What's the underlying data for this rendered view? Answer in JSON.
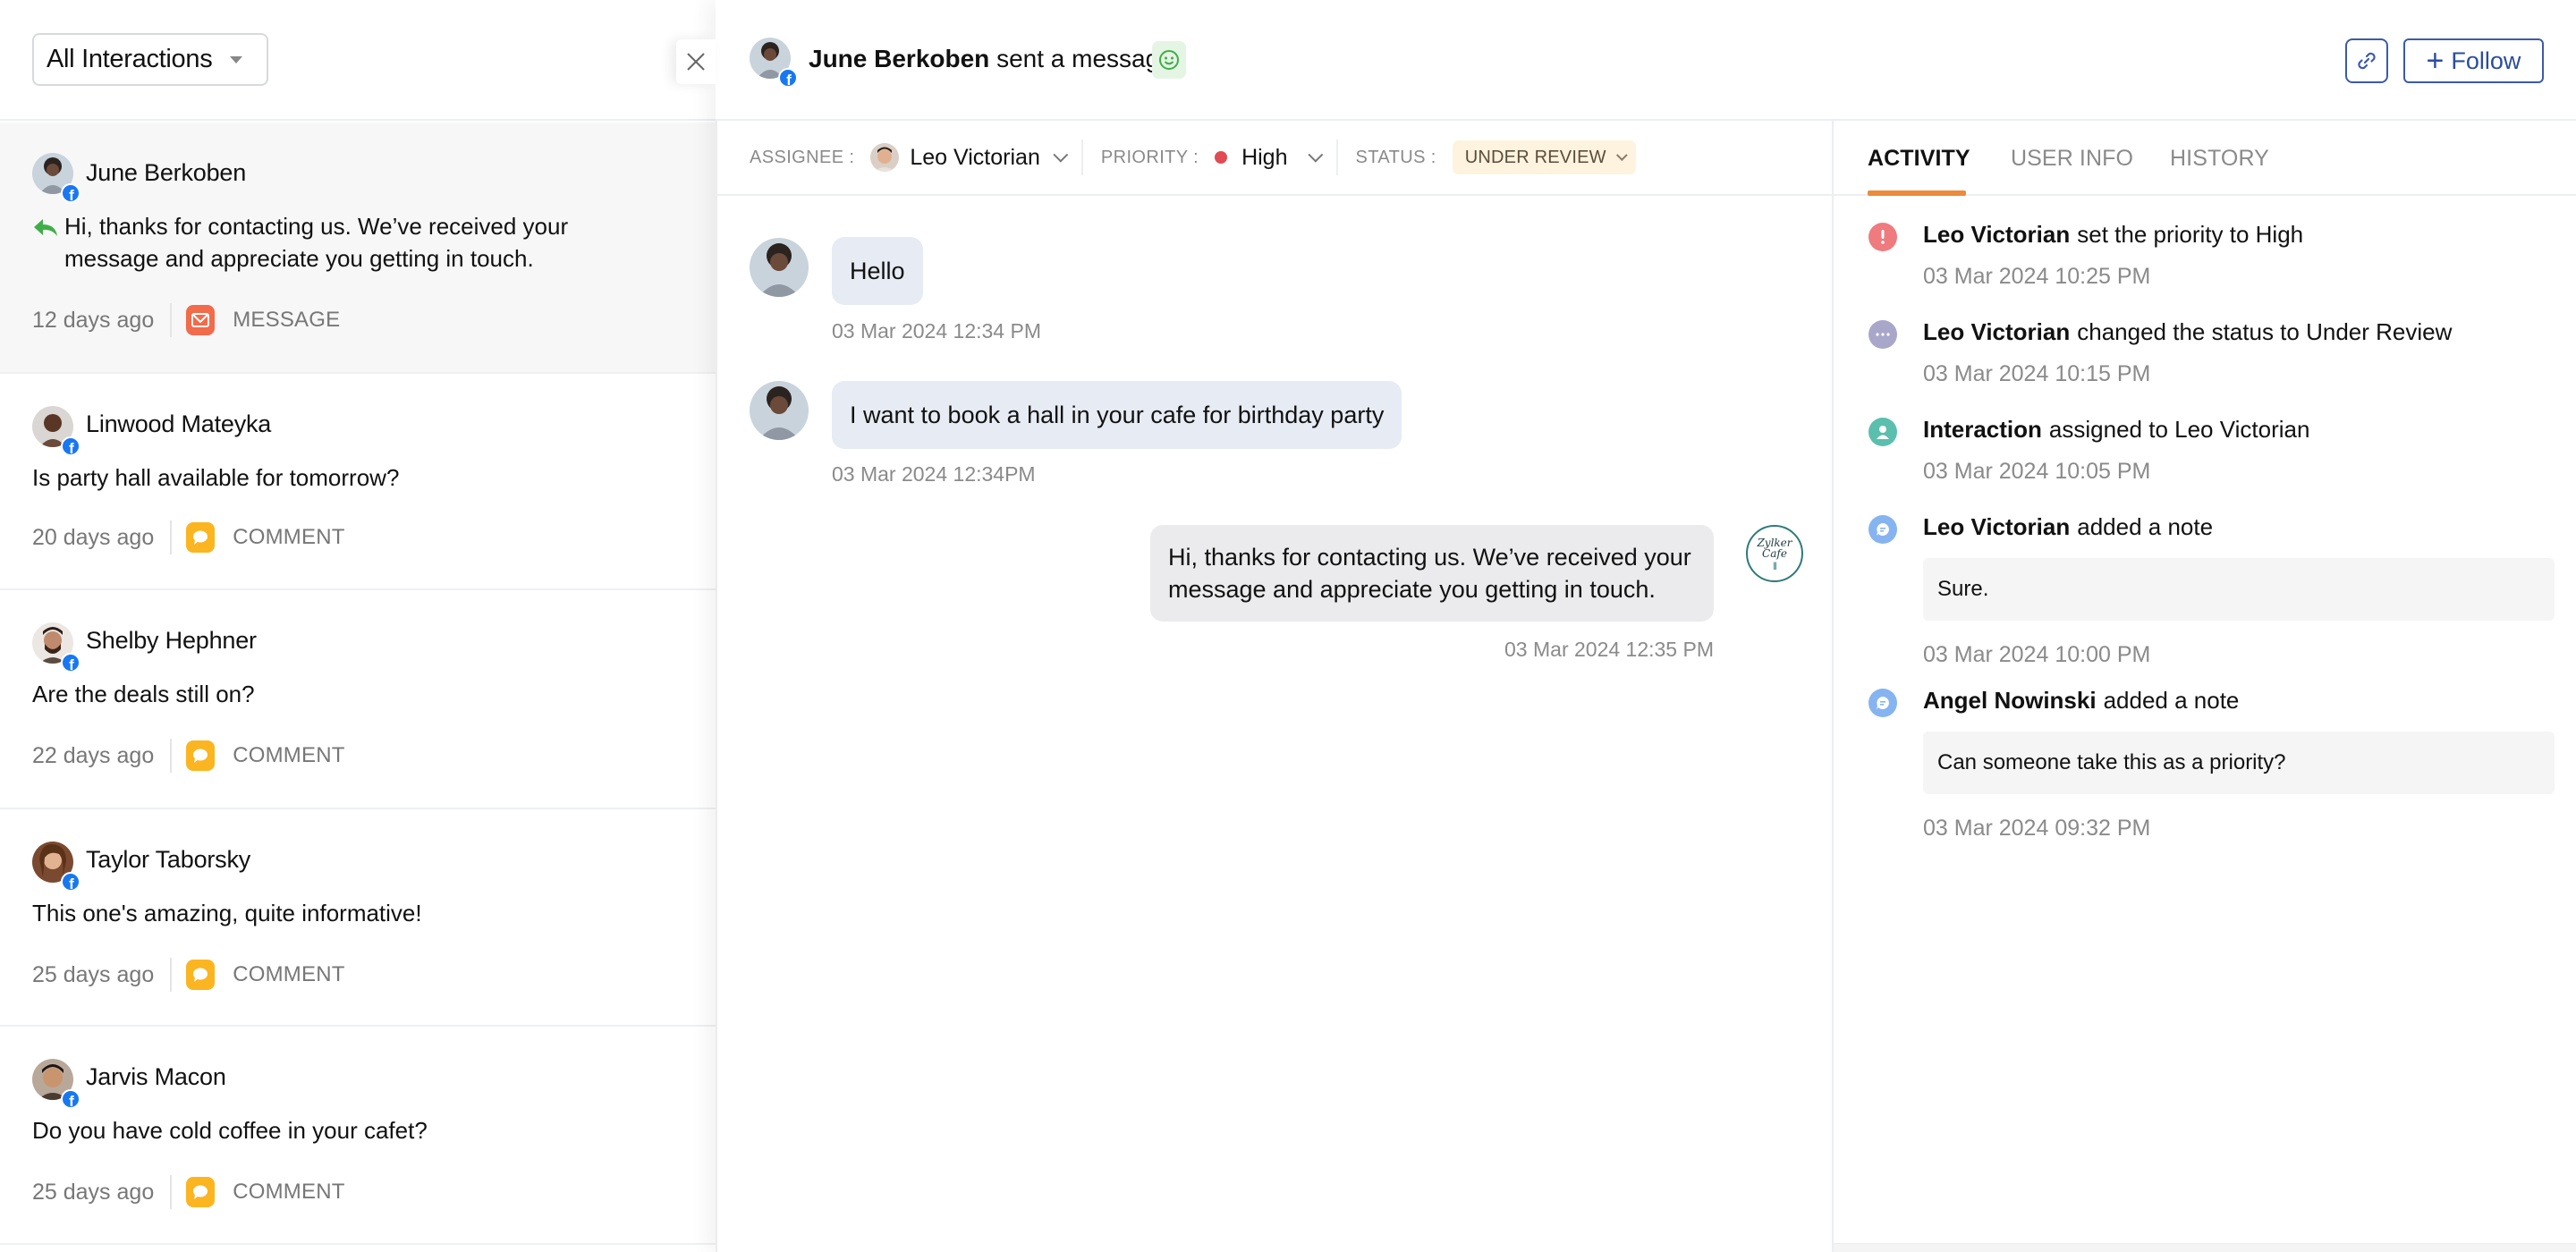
{
  "filter": {
    "label": "All Interactions"
  },
  "interactions": [
    {
      "name": "June Berkoben",
      "message": "Hi, thanks for contacting us. We’ve received your message and appreciate you getting in touch.",
      "replied": true,
      "ago": "12 days ago",
      "type": "MESSAGE",
      "type_icon": "mail-icon",
      "type_color": "#f26b4a",
      "channel": "facebook",
      "avatar_color": "#c9d3dc",
      "selected": true
    },
    {
      "name": "Linwood Mateyka",
      "message": "Is party hall available for tomorrow?",
      "replied": false,
      "ago": "20 days ago",
      "type": "COMMENT",
      "type_icon": "comment-icon",
      "type_color": "#fbb521",
      "channel": "facebook",
      "avatar_color": "#a0705a",
      "selected": false
    },
    {
      "name": "Shelby Hephner",
      "message": "Are the deals still on?",
      "replied": false,
      "ago": "22 days ago",
      "type": "COMMENT",
      "type_icon": "comment-icon",
      "type_color": "#fbb521",
      "channel": "facebook",
      "avatar_color": "#8a5a44",
      "selected": false
    },
    {
      "name": "Taylor Taborsky",
      "message": "This one's amazing, quite informative!",
      "replied": false,
      "ago": "25 days ago",
      "type": "COMMENT",
      "type_icon": "comment-icon",
      "type_color": "#fbb521",
      "channel": "facebook",
      "avatar_color": "#b07a52",
      "selected": false
    },
    {
      "name": "Jarvis Macon",
      "message": "Do you have cold  coffee in your cafet?",
      "replied": false,
      "ago": "25 days ago",
      "type": "COMMENT",
      "type_icon": "comment-icon",
      "type_color": "#fbb521",
      "channel": "facebook",
      "avatar_color": "#9a7560",
      "selected": false
    }
  ],
  "header": {
    "sender": "June Berkoben",
    "action": "sent a message",
    "sentiment_icon": "smiley-icon",
    "link_icon": "link-icon",
    "follow_label": "Follow"
  },
  "toolbar": {
    "assignee_label": "ASSIGNEE :",
    "assignee": "Leo Victorian",
    "priority_label": "PRIORITY :",
    "priority": "High",
    "priority_color": "#e04c53",
    "status_label": "STATUS :",
    "status": "UNDER REVIEW"
  },
  "conversation": [
    {
      "direction": "in",
      "text": "Hello",
      "time": "03 Mar 2024 12:34 PM"
    },
    {
      "direction": "in",
      "text": "I want to book a hall in your cafe for birthday party",
      "time": "03 Mar 2024 12:34PM"
    },
    {
      "direction": "out",
      "text": "Hi, thanks for contacting us. We’ve received your message and appreciate you getting in touch.",
      "time": "03 Mar 2024 12:35 PM",
      "brand_line1": "Zylker",
      "brand_line2": "Cafe"
    }
  ],
  "tabs": [
    {
      "label": "ACTIVITY",
      "active": true
    },
    {
      "label": "USER INFO",
      "active": false
    },
    {
      "label": "HISTORY",
      "active": false
    }
  ],
  "activity": [
    {
      "icon": "alert-icon",
      "icon_color": "#ef7b7f",
      "actor": "Leo Victorian",
      "text": "set the priority to High",
      "note": null,
      "time": "03 Mar 2024 10:25 PM"
    },
    {
      "icon": "more-icon",
      "icon_color": "#a9a7c9",
      "actor": "Leo Victorian",
      "text": "changed the status to Under Review",
      "note": null,
      "time": "03 Mar 2024 10:15 PM"
    },
    {
      "icon": "user-icon",
      "icon_color": "#5bbfae",
      "actor": "Interaction",
      "text": "assigned to Leo Victorian",
      "note": null,
      "time": "03 Mar 2024 10:05 PM"
    },
    {
      "icon": "note-icon",
      "icon_color": "#86b4f1",
      "actor": "Leo Victorian",
      "text": "added a note",
      "note": "Sure.",
      "time": "03 Mar 2024 10:00 PM"
    },
    {
      "icon": "note-icon",
      "icon_color": "#86b4f1",
      "actor": "Angel Nowinski",
      "text": "added a note",
      "note": "Can someone take this as a priority?",
      "time": "03 Mar 2024 09:32 PM"
    }
  ]
}
